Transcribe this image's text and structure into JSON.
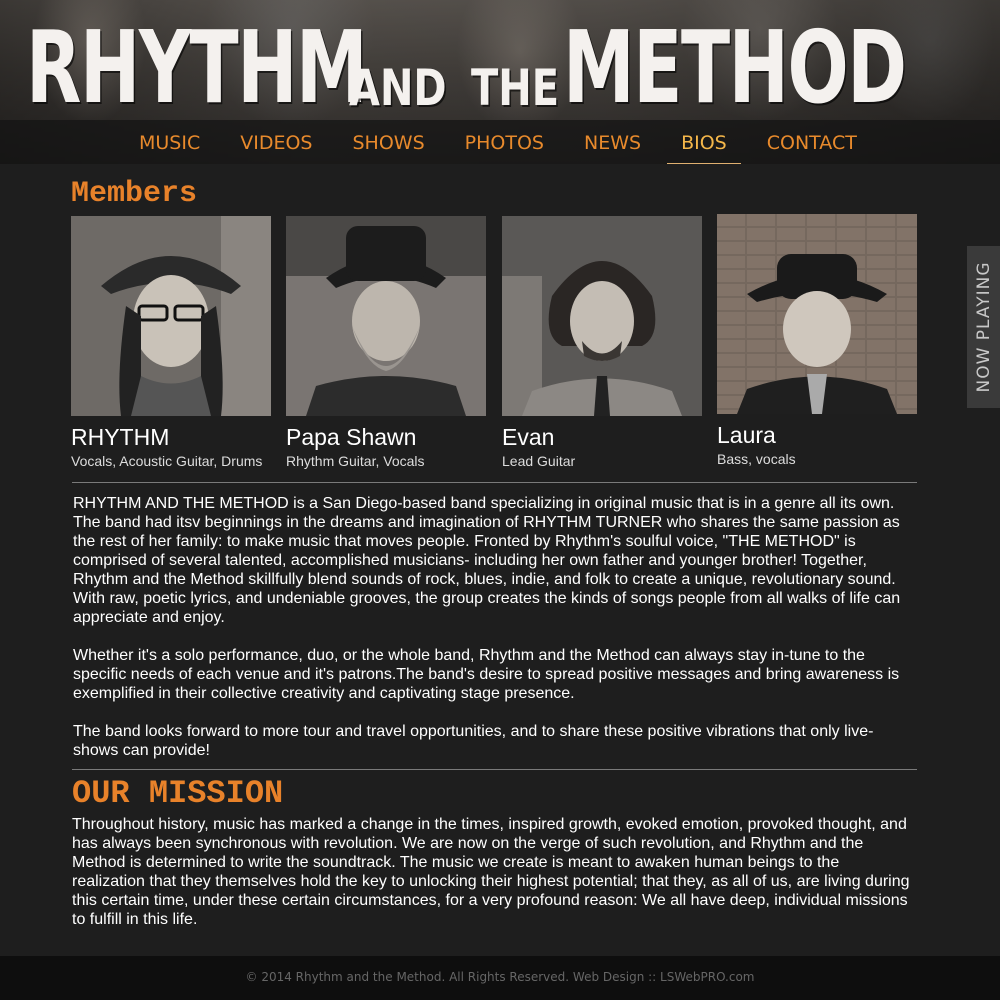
{
  "header": {
    "logo": {
      "part1": "RHYTHM",
      "part2": "AND",
      "part3": "THE",
      "part4": "METHOD"
    },
    "nav": [
      {
        "label": "MUSIC"
      },
      {
        "label": "VIDEOS"
      },
      {
        "label": "SHOWS"
      },
      {
        "label": "PHOTOS"
      },
      {
        "label": "NEWS"
      },
      {
        "label": "BIOS",
        "active": true
      },
      {
        "label": "CONTACT"
      }
    ]
  },
  "members": {
    "title": "Members",
    "list": [
      {
        "name": "RHYTHM",
        "role": "Vocals, Acoustic Guitar, Drums"
      },
      {
        "name": "Papa Shawn",
        "role": "Rhythm Guitar, Vocals"
      },
      {
        "name": "Evan",
        "role": "Lead Guitar"
      },
      {
        "name": "Laura",
        "role": "Bass, vocals"
      }
    ]
  },
  "bio": {
    "p1": "RHYTHM AND THE METHOD is a San Diego-based band specializing in original music that is in a genre all its own. The band had itsv beginnings in the dreams and imagination of RHYTHM TURNER who shares the same passion as the rest of her family: to make music that moves people. Fronted by Rhythm's soulful voice, \"THE METHOD\" is comprised of several talented, accomplished musicians- including her own father and younger brother! Together, Rhythm and the Method skillfully blend sounds of rock, blues, indie, and folk to create a unique, revolutionary sound. With raw, poetic lyrics, and undeniable grooves, the group creates the kinds of songs people from all walks of life can appreciate and enjoy.",
    "p2": "Whether it's a solo performance, duo, or the whole band, Rhythm and the Method can always stay in-tune to the specific needs of each venue and it's patrons.The band's desire to spread positive messages and bring awareness is exemplified in their collective creativity and captivating stage presence.",
    "p3": "The band looks forward to more tour and travel opportunities, and to share these positive vibrations that only live-shows can provide!"
  },
  "mission": {
    "title": "OUR MISSION",
    "text": "Throughout history, music has marked a change in the times, inspired growth, evoked emotion, provoked thought, and has always been synchronous with revolution. We are now on the verge of such revolution, and Rhythm and the Method is determined to write the soundtrack. The music we create is meant to awaken human beings to the realization that they themselves hold the key to unlocking their highest potential; that they, as all of us, are living during this certain time, under these certain circumstances, for a very profound reason: We all have deep, individual missions to fulfill in this life."
  },
  "now_playing": "NOW PLAYING",
  "footer": "© 2014 Rhythm and the Method. All Rights Reserved. Web Design :: LSWebPRO.com",
  "colors": {
    "accent": "#e8822a",
    "nav_text": "#e88a2c",
    "background": "#1e1e1e"
  }
}
